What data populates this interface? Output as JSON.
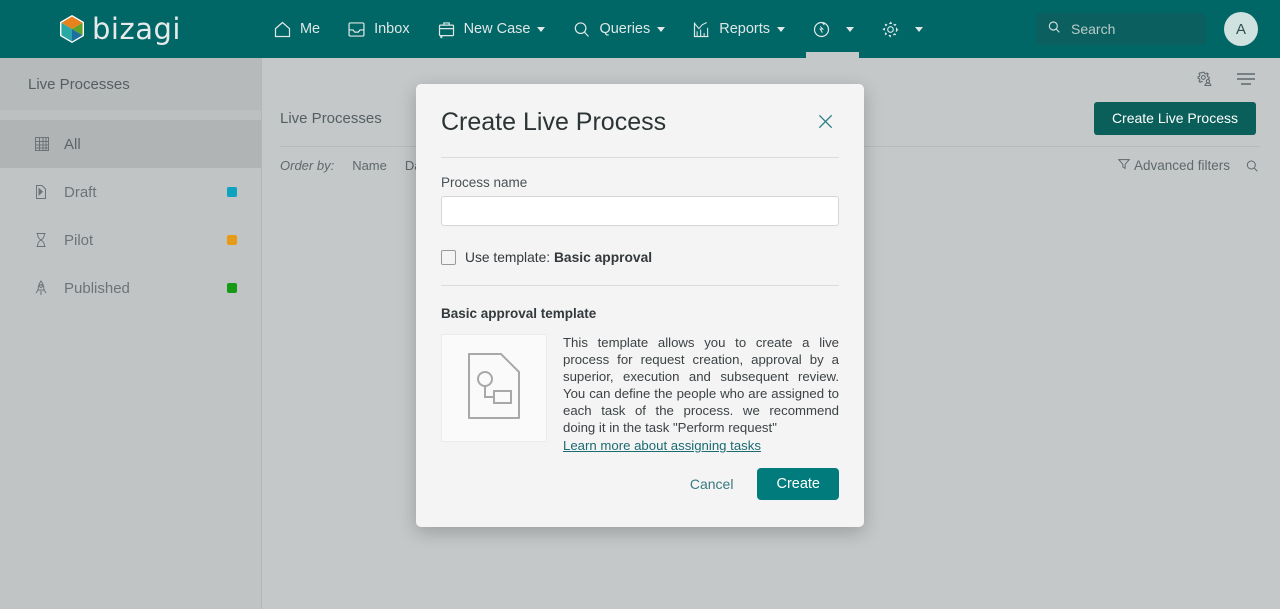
{
  "brand": {
    "name": "bizagi",
    "primary_color": "#006666",
    "accent_color": "#017b7b"
  },
  "topnav": {
    "items": [
      {
        "label": "Me",
        "icon": "home-icon",
        "has_caret": false,
        "active": false
      },
      {
        "label": "Inbox",
        "icon": "inbox-icon",
        "has_caret": false,
        "active": false
      },
      {
        "label": "New Case",
        "icon": "briefcase-plus-icon",
        "has_caret": true,
        "active": false
      },
      {
        "label": "Queries",
        "icon": "search-icon",
        "has_caret": true,
        "active": false
      },
      {
        "label": "Reports",
        "icon": "chart-icon",
        "has_caret": true,
        "active": false
      },
      {
        "label": "",
        "icon": "live-processes-icon",
        "has_caret": true,
        "active": true
      },
      {
        "label": "",
        "icon": "gear-icon",
        "has_caret": true,
        "active": false
      }
    ],
    "search": {
      "placeholder": "Search",
      "value": "",
      "icon": "search-icon"
    },
    "avatar": {
      "initial": "A"
    }
  },
  "sidebar": {
    "title": "Live Processes",
    "items": [
      {
        "label": "All",
        "icon": "grid-icon",
        "selected": true,
        "dot": ""
      },
      {
        "label": "Draft",
        "icon": "draft-page-icon",
        "selected": false,
        "dot": "#0ba3bd"
      },
      {
        "label": "Pilot",
        "icon": "hourglass-icon",
        "selected": false,
        "dot": "#e79b17"
      },
      {
        "label": "Published",
        "icon": "rocket-icon",
        "selected": false,
        "dot": "#179b17"
      }
    ]
  },
  "main": {
    "toolbar_icons": [
      {
        "name": "admin-gear-user-icon"
      },
      {
        "name": "hamburger-menu-icon"
      }
    ],
    "page_title": "Live Processes",
    "create_button": "Create Live Process",
    "order_by_label": "Order by:",
    "order_by_options": [
      "Name",
      "Date"
    ],
    "advanced_filters": "Advanced filters",
    "search_icon": "search-icon"
  },
  "modal": {
    "title": "Create Live Process",
    "close_icon": "close-icon",
    "process_name_label": "Process name",
    "process_name_value": "",
    "process_name_placeholder": "",
    "use_template_prefix": "Use template: ",
    "use_template_name": "Basic approval",
    "use_template_checked": false,
    "template_section_title": "Basic approval template",
    "template_thumb_icon": "process-document-icon",
    "template_description": "This template allows you to create a live process for request creation, approval by a superior, execution and subsequent review. You can define the people who are assigned to each task of the process. we recommend doing it in the task \"Perform request\"",
    "template_link": "Learn more about assigning tasks",
    "cancel_label": "Cancel",
    "create_label": "Create"
  }
}
